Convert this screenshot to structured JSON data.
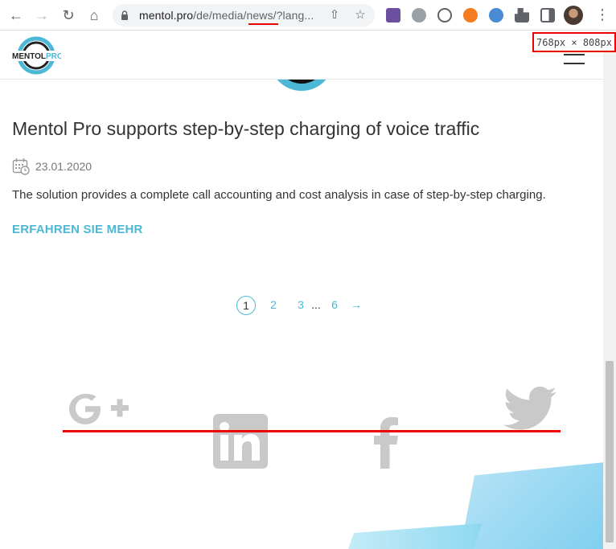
{
  "browser": {
    "url_host": "mentol.pro",
    "url_path": "/de/media/news/?lang...",
    "badge": "768px × 808px"
  },
  "site": {
    "logo_text_left": "MENTOL",
    "logo_text_right": "PRO"
  },
  "article": {
    "title": "Mentol Pro supports step-by-step charging of voice traffic",
    "date": "23.01.2020",
    "excerpt": "The solution provides a complete call accounting and cost analysis in case of step-by-step charging.",
    "more_label": "ERFAHREN SIE MEHR"
  },
  "pagination": {
    "pages": [
      "1",
      "2",
      "3"
    ],
    "ellipsis": "...",
    "last": "6",
    "next": "→"
  },
  "colors": {
    "accent": "#4cb8d6",
    "annotation_red": "#e00",
    "social_gray": "#c9c9c9"
  },
  "icons": [
    "google-plus-icon",
    "linkedin-icon",
    "facebook-icon",
    "twitter-icon"
  ]
}
